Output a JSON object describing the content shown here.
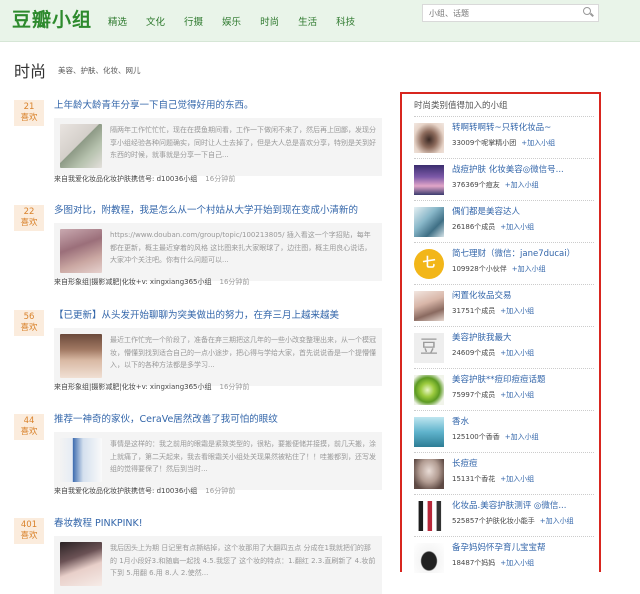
{
  "header": {
    "logo": "豆瓣小组",
    "nav": [
      "精选",
      "文化",
      "行摄",
      "娱乐",
      "时尚",
      "生活",
      "科技"
    ],
    "search_placeholder": "小组、话题"
  },
  "page": {
    "title": "时尚",
    "subtags": "美容、护肤、化妆、网儿"
  },
  "posts": [
    {
      "likes": "21",
      "likes_label": "喜欢",
      "title": "上年龄大龄青年分享一下自己觉得好用的东西。",
      "excerpt": "隔两年工作忙忙忙，现在在摸鱼期间看，工作一下做闲不来了，然后再上回鄙，发现分享小组经验各种问题确实，同时让人土去掉了，但是大人总是喜欢分享，特别是关到好东西的时候，就事就是分享一下自己...",
      "source": "来自我爱化妆品化妆护肤携信号: d10036小组",
      "time": "16分钟前"
    },
    {
      "likes": "22",
      "likes_label": "喜欢",
      "title": "多图对比，附教程，我是怎么从一个村姑从大学开始到现在变成小清新的",
      "excerpt": "https://www.douban.com/group/topic/100213805/ 插入看这一个字招贴，每年都在更新，概主最近穿着的风格 这比图来扎大家眼球了，边往图，概主用良心说话，大家冲个关注吧。你有什么问题可以...",
      "source": "来自形象组|摄影减肥|化妆+v: xingxiang365小组",
      "time": "16分钟前"
    },
    {
      "likes": "56",
      "likes_label": "喜欢",
      "title": "【已更新】从头发开始聊聊为突美做出的努力，在弃三月上越来越美",
      "excerpt": "最近工作忙完一个阶段了，准备在弃三期把这几年的一些小改变整理出来，从一个模冠妆，懵懂到找到适合自己的一点小途步，把心得与学给大家，首先说说香是一个提懵懂入，以下的各种方法都是多学习...",
      "source": "来自形象组|摄影减肥|化妆+v: xingxiang365小组",
      "time": "16分钟前"
    },
    {
      "likes": "44",
      "likes_label": "喜欢",
      "title": "推荐一神奇的家伙，CeraVe居然改善了我可怕的眼纹",
      "excerpt": "事情是这样的：我之前用的眼霜是紧致类型的，很粘，要搬便储并接摸，前几天搬，涂上就痛了，第二天起来，我去看眼霜关小组处关现果然被粘住了！！哇搬都到，还写发组的觉得要保了！然后到当时...",
      "source": "来自我爱化妆品化妆护肤携信号: d10036小组",
      "time": "16分钟前"
    },
    {
      "likes": "401",
      "likes_label": "喜欢",
      "title": "春妆教程 PINKPINK!",
      "excerpt": "我后因头上为期 日记里有点撕结掉，这个妆那用了大翻四五点 分成在1我就把们的那的 1月小段好3.和随扁一起找 4.5.我您了 这个妆的特点：1.翻红 2.3.直刷新了 4.妆前下到 5.用翻 6.用 8.人 2.使然...",
      "source": "",
      "time": ""
    }
  ],
  "sidebar": {
    "title": "时尚类别值得加入的小组",
    "join_label": "+加入小组",
    "groups": [
      {
        "name": "转啊转啊转~只转化妆品~",
        "meta": "33009个呢掌精小团"
      },
      {
        "name": "战痘护肤 化妆美容◎微信号...",
        "meta": "376369个痘友"
      },
      {
        "name": "偶们都是美容达人",
        "meta": "26186个成员"
      },
      {
        "name": "简七理财（微信：jane7ducai）",
        "meta": "109928个小伙伴"
      },
      {
        "name": "闲置化妆品交易",
        "meta": "31751个成员"
      },
      {
        "name": "美容护肤我最大",
        "meta": "24609个成员"
      },
      {
        "name": "美容护肤**痘印痘痘话题",
        "meta": "75997个成员"
      },
      {
        "name": "香水",
        "meta": "125100个香香"
      },
      {
        "name": "长痘痘",
        "meta": "15131个香花"
      },
      {
        "name": "化妆品.美容护肤测评 ◎微信...",
        "meta": "525857个护肤化妆小能手"
      },
      {
        "name": "备孕妈妈怀孕育儿宝宝帮",
        "meta": "18487个妈妈"
      }
    ]
  },
  "colors": {
    "brand": "#2d8a2d",
    "link": "#3366aa",
    "likes": "#d9822b",
    "highlight_border": "#d8261f"
  }
}
